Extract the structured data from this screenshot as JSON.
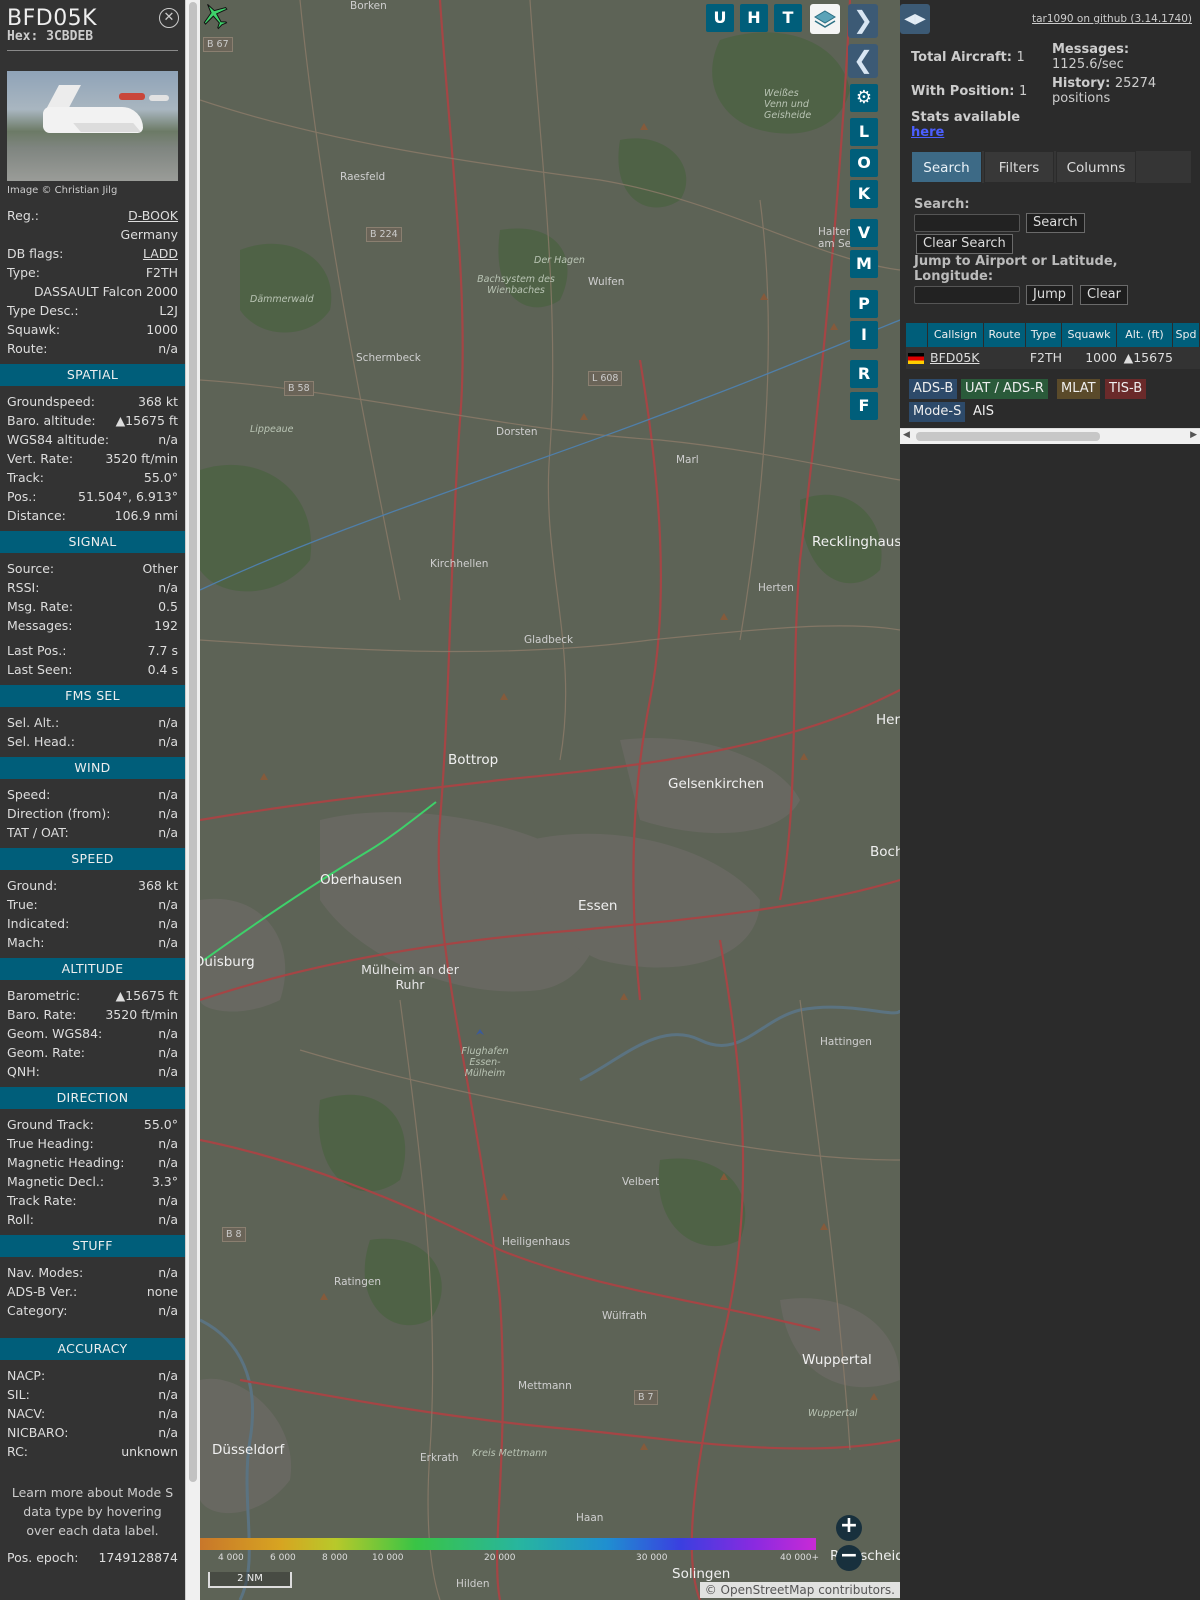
{
  "aircraft": {
    "callsign": "BFD05K",
    "hex_label": "Hex: 3CBDEB",
    "image_credit": "Image © Christian Jilg",
    "details": [
      {
        "k": "Reg.:",
        "v": "D-BOOK",
        "underline": true
      },
      {
        "k": "",
        "v": "Germany"
      },
      {
        "k": "DB flags:",
        "v": "LADD",
        "underline": true
      },
      {
        "k": "Type:",
        "v": "F2TH"
      },
      {
        "k": "",
        "v": "DASSAULT Falcon 2000"
      },
      {
        "k": "Type Desc.:",
        "v": "L2J"
      },
      {
        "k": "Squawk:",
        "v": "1000"
      },
      {
        "k": "Route:",
        "v": "n/a"
      }
    ],
    "sections": [
      {
        "title": "SPATIAL",
        "rows": [
          {
            "k": "Groundspeed:",
            "v": "368 kt"
          },
          {
            "k": "Baro. altitude:",
            "v": "▲15675 ft"
          },
          {
            "k": "WGS84 altitude:",
            "v": "n/a"
          },
          {
            "k": "Vert. Rate:",
            "v": "3520 ft/min"
          },
          {
            "k": "Track:",
            "v": "55.0°"
          },
          {
            "k": "Pos.:",
            "v": "51.504°, 6.913°"
          },
          {
            "k": "Distance:",
            "v": "106.9 nmi"
          }
        ]
      },
      {
        "title": "SIGNAL",
        "rows": [
          {
            "k": "Source:",
            "v": "Other"
          },
          {
            "k": "RSSI:",
            "v": "n/a"
          },
          {
            "k": "Msg. Rate:",
            "v": "0.5"
          },
          {
            "k": "Messages:",
            "v": "192"
          },
          {
            "k": "Last Pos.:",
            "v": "7.7 s"
          },
          {
            "k": "Last Seen:",
            "v": "0.4 s"
          }
        ]
      },
      {
        "title": "FMS SEL",
        "rows": [
          {
            "k": "Sel. Alt.:",
            "v": "n/a"
          },
          {
            "k": "Sel. Head.:",
            "v": "n/a"
          }
        ]
      },
      {
        "title": "WIND",
        "rows": [
          {
            "k": "Speed:",
            "v": "n/a"
          },
          {
            "k": "Direction (from):",
            "v": "n/a"
          },
          {
            "k": "TAT / OAT:",
            "v": "n/a"
          }
        ]
      },
      {
        "title": "SPEED",
        "rows": [
          {
            "k": "Ground:",
            "v": "368 kt"
          },
          {
            "k": "True:",
            "v": "n/a"
          },
          {
            "k": "Indicated:",
            "v": "n/a"
          },
          {
            "k": "Mach:",
            "v": "n/a"
          }
        ]
      },
      {
        "title": "ALTITUDE",
        "rows": [
          {
            "k": "Barometric:",
            "v": "▲15675 ft"
          },
          {
            "k": "Baro. Rate:",
            "v": "3520 ft/min"
          },
          {
            "k": "Geom. WGS84:",
            "v": "n/a"
          },
          {
            "k": "Geom. Rate:",
            "v": "n/a"
          },
          {
            "k": "QNH:",
            "v": "n/a"
          }
        ]
      },
      {
        "title": "DIRECTION",
        "rows": [
          {
            "k": "Ground Track:",
            "v": "55.0°"
          },
          {
            "k": "True Heading:",
            "v": "n/a"
          },
          {
            "k": "Magnetic Heading:",
            "v": "n/a"
          },
          {
            "k": "Magnetic Decl.:",
            "v": "3.3°"
          },
          {
            "k": "Track Rate:",
            "v": "n/a"
          },
          {
            "k": "Roll:",
            "v": "n/a"
          }
        ]
      },
      {
        "title": "STUFF",
        "rows": [
          {
            "k": "Nav. Modes:",
            "v": "n/a"
          },
          {
            "k": "ADS-B Ver.:",
            "v": "none"
          },
          {
            "k": "Category:",
            "v": "n/a"
          }
        ]
      },
      {
        "title": "ACCURACY",
        "rows": [
          {
            "k": "NACP:",
            "v": "n/a"
          },
          {
            "k": "SIL:",
            "v": "n/a"
          },
          {
            "k": "NACV:",
            "v": "n/a"
          },
          {
            "k": "NICBARO:",
            "v": "n/a"
          },
          {
            "k": "RC:",
            "v": "unknown"
          }
        ]
      }
    ],
    "learn_more": "Learn more about Mode S data type by hovering over each data label.",
    "pos_epoch_label": "Pos. epoch:",
    "pos_epoch_value": "1749128874"
  },
  "map": {
    "buttons": [
      "U",
      "H",
      "T",
      "L",
      "O",
      "K",
      "V",
      "M",
      "P",
      "I",
      "R",
      "F"
    ],
    "labels": [
      "Borken",
      "Raesfeld",
      "Weißes Venn und Geisheide",
      "Haltern am See",
      "Der Hagen",
      "Bachsystem des Wienbaches",
      "Wulfen",
      "Dämmerwald",
      "Schermbeck",
      "Lippeaue",
      "Dorsten",
      "Marl",
      "Recklinghaus",
      "Kirchhellen",
      "Herten",
      "Bottrop",
      "Gladbeck",
      "Gelsenkirchen",
      "Her",
      "Boch",
      "Oberhausen",
      "Essen",
      "Duisburg",
      "Mülheim an der Ruhr",
      "Flughafen Essen-Mülheim",
      "Hattingen",
      "Velbert",
      "Heiligenhaus",
      "Ratingen",
      "Wülfrath",
      "Wuppertal",
      "Mettmann",
      "Düsseldorf",
      "Erkrath",
      "Haan",
      "Solingen",
      "Hilden",
      "Remscheid",
      "Kreis Mettmann",
      "Wuppertal"
    ],
    "road_shields": [
      "B 67",
      "B 224",
      "B 58",
      "L 608",
      "B 8",
      "B 7"
    ],
    "altitude_scale": [
      "4 000",
      "6 000",
      "8 000",
      "10 000",
      "20 000",
      "30 000",
      "40 000+"
    ],
    "scale_label": "2 NM",
    "attribution": "© OpenStreetMap contributors.",
    "zoom_in": "+",
    "zoom_out": "−"
  },
  "panel": {
    "github_link": "tar1090 on github (3.14.1740)",
    "total_aircraft_label": "Total Aircraft:",
    "total_aircraft_value": "1",
    "with_position_label": "With Position:",
    "with_position_value": "1",
    "messages_label": "Messages:",
    "messages_value": "1125.6/sec",
    "history_label": "History:",
    "history_value": "25274 positions",
    "stats_label": "Stats available",
    "stats_link": "here",
    "tabs": [
      "Search",
      "Filters",
      "Columns"
    ],
    "search_label": "Search:",
    "search_button": "Search",
    "clear_search_button": "Clear Search",
    "jump_label": "Jump to Airport or Latitude, Longitude:",
    "jump_button": "Jump",
    "clear_button": "Clear",
    "table_headers": [
      "",
      "Callsign",
      "Route",
      "Type",
      "Squawk",
      "Alt. (ft)",
      "Spd"
    ],
    "table_rows": [
      {
        "callsign": "BFD05K",
        "route": "",
        "type": "F2TH",
        "squawk": "1000",
        "alt": "▲15675",
        "spd": ""
      }
    ],
    "source_chips": [
      {
        "label": "ADS-B",
        "color": "#2d4a6a"
      },
      {
        "label": "UAT / ADS-R",
        "color": "#2a5a3a"
      },
      {
        "label": "MLAT",
        "color": "#5a4a2a"
      },
      {
        "label": "TIS-B",
        "color": "#6a2a2a"
      },
      {
        "label": "Mode-S",
        "color": "#2d4a6a"
      },
      {
        "label": "AIS",
        "color": "#2b2b2b"
      }
    ]
  },
  "colors": {
    "section_header": "#005e7a",
    "panel_bg": "#2b2b2b",
    "sidebar_bg": "#333333",
    "track_color": "#3ed16a"
  }
}
